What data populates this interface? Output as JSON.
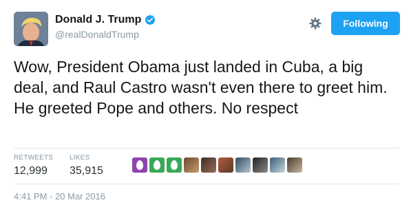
{
  "user": {
    "display_name": "Donald J. Trump",
    "handle": "@realDonaldTrump",
    "verified_icon": "verified-badge-icon"
  },
  "actions": {
    "settings_icon": "gear-icon",
    "follow_label": "Following"
  },
  "tweet": {
    "text": "Wow, President Obama just landed in Cuba, a big deal, and Raul Castro wasn't even there to greet him. He greeted Pope and others. No respect",
    "timestamp": "4:41 PM - 20 Mar 2016"
  },
  "stats": {
    "retweets_label": "RETWEETS",
    "retweets_value": "12,999",
    "likes_label": "LIKES",
    "likes_value": "35,915"
  },
  "likers": [
    {
      "kind": "egg",
      "color": "#8e44ad"
    },
    {
      "kind": "egg",
      "color": "#3aa757"
    },
    {
      "kind": "egg",
      "color": "#3aa757"
    },
    {
      "kind": "photo",
      "c1": "#6b4a2e",
      "c2": "#c69b6d"
    },
    {
      "kind": "photo",
      "c1": "#3b2f2a",
      "c2": "#9a6b55"
    },
    {
      "kind": "photo",
      "c1": "#b45a3c",
      "c2": "#5a3a2a"
    },
    {
      "kind": "photo",
      "c1": "#2f4c5e",
      "c2": "#b7c4cf"
    },
    {
      "kind": "photo",
      "c1": "#222222",
      "c2": "#8a8a8a"
    },
    {
      "kind": "photo",
      "c1": "#3a5f7a",
      "c2": "#c9d6db"
    },
    {
      "kind": "photo",
      "c1": "#4a3a2c",
      "c2": "#c7b79e"
    }
  ],
  "colors": {
    "accent": "#1da1f2",
    "muted": "#8899a6",
    "text": "#14171a"
  }
}
